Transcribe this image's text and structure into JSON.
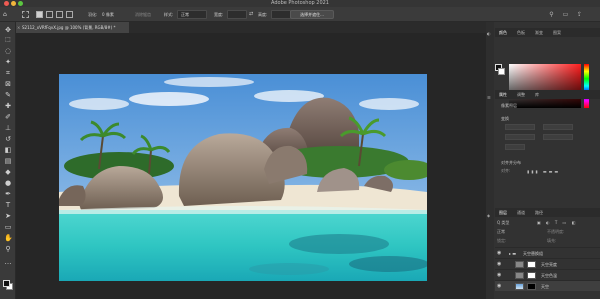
{
  "window": {
    "title": "Adobe Photoshop 2021"
  },
  "options_bar": {
    "feather_label": "羽化:",
    "feather_value": "0 像素",
    "antialias_label": "消除锯齿",
    "style_label": "样式:",
    "style_value": "正常",
    "width_label": "宽度:",
    "height_label": "高度:",
    "select_mask_label": "选择并遮住..."
  },
  "document_tab": {
    "close_glyph": "×",
    "title": "S2112_xVRfFqvX.jpg @ 100% (背景, RGB/8#) *"
  },
  "panels": {
    "color": {
      "tabs": [
        "颜色",
        "色板",
        "渐变",
        "图案"
      ]
    },
    "properties": {
      "tabs": [
        "属性",
        "调整",
        "库"
      ],
      "layer_label": "像素图层",
      "transform_label": "变换",
      "align_label": "对齐并分布",
      "align_sub": "对齐:"
    },
    "layers": {
      "tabs": [
        "图层",
        "通道",
        "路径"
      ],
      "search_label": "Q 类型",
      "mode_label": "正常",
      "opacity_label": "不透明度:",
      "lock_label": "锁定:",
      "fill_label": "填充:",
      "items": [
        {
          "name": "天空替换组"
        },
        {
          "name": "天空亮度"
        },
        {
          "name": "天空色温"
        },
        {
          "name": "天空"
        }
      ]
    }
  },
  "colors": {
    "accent_red": "#ff1e1e",
    "panel_bg": "#323232",
    "canvas_bg": "#262626"
  }
}
